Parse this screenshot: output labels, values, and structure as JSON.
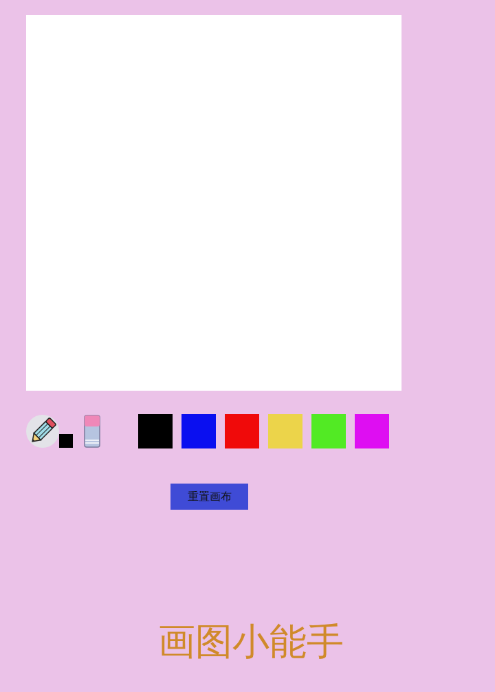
{
  "tools": [
    {
      "kind": "pencil",
      "selected": true,
      "color": "#000000"
    },
    {
      "kind": "eraser",
      "selected": false
    }
  ],
  "palette": [
    {
      "color": "#000000"
    },
    {
      "color": "#0a0ff0"
    },
    {
      "color": "#f00a0a"
    },
    {
      "color": "#ecd44a"
    },
    {
      "color": "#52ea24"
    },
    {
      "color": "#de0ef2"
    }
  ],
  "reset_button": "重置画布",
  "title": "画图小能手"
}
